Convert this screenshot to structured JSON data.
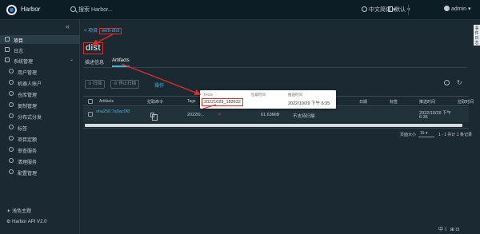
{
  "header": {
    "brand": "Harbor",
    "search_placeholder": "搜索 Harbor...",
    "language": "中文简体",
    "docs": "默认",
    "user": "admin"
  },
  "sidebar": {
    "items": [
      {
        "label": "项目",
        "active": true
      },
      {
        "label": "日志"
      },
      {
        "label": "系统管理",
        "expandable": true
      }
    ],
    "sub_items": [
      {
        "label": "用户管理"
      },
      {
        "label": "机器人账户"
      },
      {
        "label": "仓库管理"
      },
      {
        "label": "复制管理"
      },
      {
        "label": "分布式分发"
      },
      {
        "label": "标签"
      },
      {
        "label": "项目定额"
      },
      {
        "label": "审查服务"
      },
      {
        "label": "清理服务"
      },
      {
        "label": "配置管理"
      }
    ],
    "theme_label": "浅色主题",
    "api_label": "Harbor API V2.0"
  },
  "event_strip": "事件日志",
  "breadcrumb": {
    "parent": "< 项目",
    "current": "web-dist"
  },
  "page_title": "dist",
  "tabs": [
    {
      "label": "描述信息"
    },
    {
      "label": "Artifacts",
      "active": true
    }
  ],
  "toolbar": {
    "scan": "扫描",
    "stop_scan": "停止扫描",
    "actions": "操作"
  },
  "table": {
    "columns": [
      "Artifacts",
      "拉取命令",
      "Tags",
      "标签",
      "日期",
      "标签",
      "推送时间",
      "拉取时间"
    ],
    "rows": [
      {
        "artifact": "sha256:7a9ac0f8",
        "tag": "2022l0...",
        "size": "61.63MiB",
        "vuln": "不支持扫描",
        "push_time": "2022/10/29 下午",
        "push_time2": "6:35"
      }
    ]
  },
  "popup": {
    "h_tags": "TAGS",
    "h_pull": "拉取时间",
    "h_push": "推送时间",
    "tag": "20221029_183632",
    "push_time": "2022/10/29 下午 6:35"
  },
  "pagination": {
    "page_size_label": "页面大小",
    "page_size": "15",
    "range": "1 - 1 共计 1 条记录"
  },
  "corner": "中 ☾ ⊞ ⊡"
}
